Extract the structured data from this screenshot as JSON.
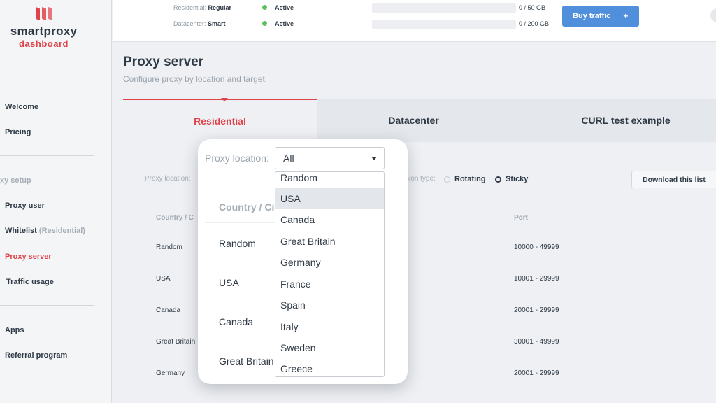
{
  "brand": {
    "name": "smartproxy",
    "sub": "dashboard",
    "accent": "#e0424a"
  },
  "sidebar": {
    "items": [
      {
        "label": "Welcome"
      },
      {
        "label": "Pricing"
      },
      {
        "label": "Proxy user"
      },
      {
        "label": "Whitelist",
        "note": "(Residential)"
      },
      {
        "label": "Proxy server",
        "active": true
      },
      {
        "label": "Traffic usage"
      },
      {
        "label": "Apps"
      },
      {
        "label": "Referral program"
      }
    ],
    "section_label": "xy setup"
  },
  "topbar": {
    "plans": [
      {
        "type": "Residential:",
        "plan": "Regular",
        "status": "Active",
        "usage": "0 / 50 GB",
        "used_fraction": 0
      },
      {
        "type": "Datacenter:",
        "plan": "Smart",
        "status": "Active",
        "usage": "0 / 200 GB",
        "used_fraction": 0
      }
    ],
    "buy_label": "Buy traffic",
    "buy_icon": "+",
    "buy_color": "#4f8fdb",
    "status_color": "#5cc25a"
  },
  "page": {
    "title": "Proxy server",
    "subtitle": "Configure proxy by location and target."
  },
  "tabs": [
    {
      "label": "Residential",
      "active": true
    },
    {
      "label": "Datacenter"
    },
    {
      "label": "CURL test example"
    }
  ],
  "filters": {
    "proxy_location_label": "Proxy location:",
    "session_type_label": "sion type:",
    "rotating_label": "Rotating",
    "sticky_label": "Sticky",
    "selected_session": "Sticky",
    "download_label": "Download this list"
  },
  "table": {
    "headers": {
      "country": "Country / C",
      "port": "Port"
    },
    "rows": [
      {
        "country": "Random",
        "port": "10000 - 49999"
      },
      {
        "country": "USA",
        "port": "10001 - 29999"
      },
      {
        "country": "Canada",
        "port": "20001 - 29999"
      },
      {
        "country": "Great Britain",
        "port": "30001 - 49999"
      },
      {
        "country": "Germany",
        "port": "20001 - 29999"
      }
    ]
  },
  "popover": {
    "label": "Proxy location:",
    "select_value": "All",
    "table_header": "Country / Cit",
    "table_rows": [
      "Random",
      "USA",
      "Canada",
      "Great Britain"
    ],
    "options": [
      "Random",
      "USA",
      "Canada",
      "Great Britain",
      "Germany",
      "France",
      "Spain",
      "Italy",
      "Sweden",
      "Greece"
    ],
    "highlighted": "USA"
  }
}
